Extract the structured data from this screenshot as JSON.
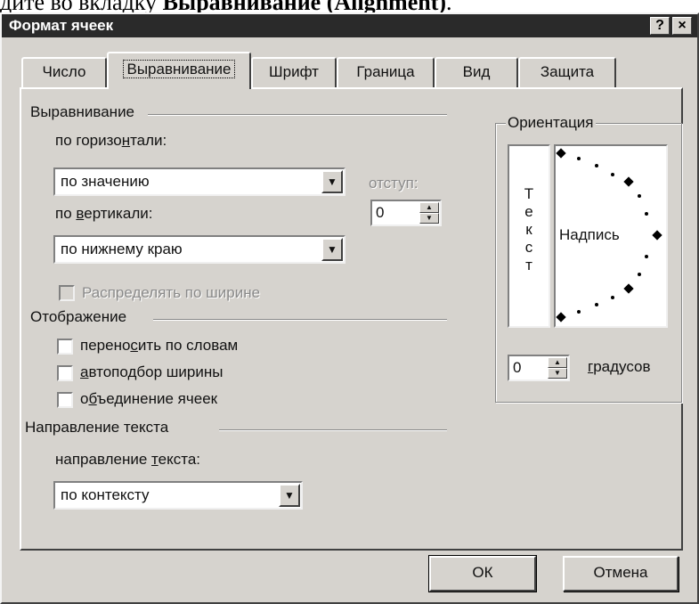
{
  "caption": {
    "prefix": "дите во вкладку ",
    "bold": "Выравнивание (Alignment)",
    "suffix": "."
  },
  "window": {
    "title": "Формат ячеек",
    "help_label": "?",
    "close_label": "×"
  },
  "tabs": [
    {
      "label": "Число"
    },
    {
      "label": "Выравнивание"
    },
    {
      "label": "Шрифт"
    },
    {
      "label": "Граница"
    },
    {
      "label": "Вид"
    },
    {
      "label": "Защита"
    }
  ],
  "alignment": {
    "section_title": "Выравнивание",
    "horizontal": {
      "label_a": "по горизо",
      "label_u": "н",
      "label_b": "тали:",
      "value": "по значению"
    },
    "indent": {
      "label": "отступ:",
      "value": "0"
    },
    "vertical": {
      "label_a": "по ",
      "label_u": "в",
      "label_b": "ертикали:",
      "value": "по нижнему краю"
    },
    "distribute_label": "Распределять по ширине"
  },
  "display": {
    "section_title": "Отображение",
    "wrap": {
      "a": "перено",
      "u": "с",
      "b": "ить по словам"
    },
    "autofit": {
      "a": "",
      "u": "а",
      "b": "втоподбор ширины"
    },
    "merge": {
      "a": "о",
      "u": "б",
      "b": "ъединение ячеек"
    }
  },
  "direction": {
    "section_title": "Направление текста",
    "label_a": "направление ",
    "label_u": "т",
    "label_b": "екста:",
    "value": "по контексту"
  },
  "orientation": {
    "section_title": "Ориентация",
    "vertical_letters": [
      "Т",
      "е",
      "к",
      "с",
      "т"
    ],
    "inscription": "Надпись",
    "degrees_value": "0",
    "degrees_label_u": "г",
    "degrees_label_b": "радусов"
  },
  "buttons": {
    "ok": "ОК",
    "cancel": "Отмена"
  }
}
